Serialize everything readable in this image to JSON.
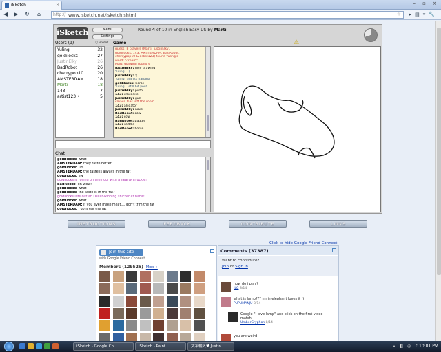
{
  "browser": {
    "tab_title": "iSketch",
    "url_lead": "http://",
    "url": "www.isketch.net/isketch.shtml"
  },
  "game": {
    "logo": "iSketch",
    "menu_label": "Menu",
    "settings_label": "Settings",
    "round_text_pre": "Round ",
    "round_num": "4",
    "round_text_mid": " of 10 in English Easy US by ",
    "drawer": "Marti",
    "users_label": "Users (9)",
    "away_label": "AWAY",
    "game_label": "Game",
    "chat_label": "Chat",
    "users": [
      {
        "name": "Yuling",
        "score": "32",
        "state": "normal"
      },
      {
        "name": "goldilocks",
        "score": "27",
        "state": "normal"
      },
      {
        "name": "JustinElky",
        "score": "26",
        "state": "dim"
      },
      {
        "name": "BadRobot",
        "score": "26",
        "state": "normal"
      },
      {
        "name": "cherrypop10",
        "score": "20",
        "state": "normal"
      },
      {
        "name": "AMSTERDAM",
        "score": "18",
        "state": "normal"
      },
      {
        "name": "Marti",
        "score": "18",
        "state": "me"
      },
      {
        "name": "143",
        "score": "7",
        "state": "normal"
      },
      {
        "name": "artist123 •",
        "score": "5",
        "state": "normal"
      }
    ],
    "gamelog": [
      {
        "style": "red",
        "nick": "",
        "text": "guess: 8 players (Marti, JustinElky,"
      },
      {
        "style": "red",
        "nick": "",
        "text": "goldilocks, 143, AMSTERDAM, BadRobot,"
      },
      {
        "style": "red",
        "nick": "",
        "text": "cherrypop10 & artist123) found Yuling's"
      },
      {
        "style": "red",
        "nick": "",
        "text": "word: \"cream\""
      },
      {
        "style": "red",
        "nick": "",
        "text": "Marti drawing round 4"
      },
      {
        "style": "",
        "nick": "JustinElky:",
        "text": " nice drawing"
      },
      {
        "style": "blue",
        "nick": "",
        "text": "Yuling: : )"
      },
      {
        "style": "",
        "nick": "JustinElky:",
        "text": " :("
      },
      {
        "style": "blue",
        "nick": "",
        "text": "Yuling: thanks hahaha"
      },
      {
        "style": "",
        "nick": "goldilocks:",
        "text": " horse"
      },
      {
        "style": "blue",
        "nick": "",
        "text": "Yuling: i still hit you!"
      },
      {
        "style": "",
        "nick": "JustinElky:",
        "text": " pistol"
      },
      {
        "style": "",
        "nick": "143:",
        "text": " crocodile"
      },
      {
        "style": "",
        "nick": "JustinElky:",
        "text": " gun"
      },
      {
        "style": "red",
        "nick": "",
        "text": "cmacs. has left the room."
      },
      {
        "style": "",
        "nick": "143:",
        "text": " alligator"
      },
      {
        "style": "",
        "nick": "JustinElky:",
        "text": " nove"
      },
      {
        "style": "",
        "nick": "BadRobot:",
        "text": " cow"
      },
      {
        "style": "",
        "nick": "143:",
        "text": " cow"
      },
      {
        "style": "",
        "nick": "BadRobot:",
        "text": " paddle"
      },
      {
        "style": "",
        "nick": "143:",
        "text": " saddle"
      },
      {
        "style": "",
        "nick": "BadRobot:",
        "text": " horse"
      }
    ],
    "chatlog": [
      {
        "style": "",
        "nick": "goldilocks:",
        "text": " what"
      },
      {
        "style": "",
        "nick": "AMSTERDAM:",
        "text": " they taste better"
      },
      {
        "style": "",
        "nick": "goldilocks:",
        "text": " um"
      },
      {
        "style": "",
        "nick": "AMSTERDAM:",
        "text": " the taste is always in the fat"
      },
      {
        "style": "",
        "nick": "goldilocks:",
        "text": " ew"
      },
      {
        "style": "pink",
        "nick": "",
        "text": "goldilocks is rolling on the floor with a hearty chuckle!"
      },
      {
        "style": "",
        "nick": "BadRobot:",
        "text": " oh wow!"
      },
      {
        "style": "",
        "nick": "goldilocks:",
        "text": " what"
      },
      {
        "style": "",
        "nick": "goldilocks:",
        "text": " the taste is in the fat?"
      },
      {
        "style": "pink",
        "nick": "",
        "text": "goldilocks lets out an Oscar-winning snicker at haha!"
      },
      {
        "style": "",
        "nick": "goldilocks:",
        "text": " what"
      },
      {
        "style": "",
        "nick": "AMSTERDAM:",
        "text": " if you ever make meat.... don't trim the fat"
      },
      {
        "style": "",
        "nick": "goldilocks:",
        "text": " i dont eat the fat"
      }
    ]
  },
  "buttons": {
    "instructions": "INSTRUCTIONS",
    "feedback": "FEEDBACK",
    "contribute": "CONTRIBUTE",
    "links": "LINKS"
  },
  "gfc": {
    "hide_link": "Click to hide Google Friend Connect",
    "join_label": "Join this site",
    "sub_label": "with Google Friend Connect",
    "members_label": "Members (129525)",
    "more_label": "More »"
  },
  "comments": {
    "header": "Comments (37387)",
    "want_text": "Want to contribute?",
    "join": "Join",
    "or": " or ",
    "signin": "Sign in",
    "items": [
      {
        "text": "how do i play?",
        "author": "ILG",
        "date": " 8/14"
      },
      {
        "text": "what is lamp??? mr irrelephant loves it :)",
        "author": "PUPUMANJU",
        "date": " 8/14"
      },
      {
        "text": "Google \"I love lamp\" and click on the first video",
        "text2": "match.",
        "author": "UmberGryphon",
        "date": " 8/14"
      },
      {
        "text": "you are weird",
        "author": "",
        "date": ""
      }
    ]
  },
  "taskbar": {
    "tasks": [
      "iSketch - Google Ch...",
      "iSketch - Paint",
      "文字輸入♥ Justin..."
    ],
    "clock": "10:01 PM"
  },
  "colors": {
    "avatars": [
      "#7a5a48",
      "#c9a27e",
      "#3a3a3a",
      "#b07060",
      "#d8d2c8",
      "#6b7a8c",
      "#2e2e2e",
      "#c28a6a",
      "#8b6b5a",
      "#e0c0a0",
      "#5a6a7a",
      "#a05a50",
      "#b8b8b8",
      "#4a4a4a",
      "#9a7a60",
      "#cf9f80",
      "#2a2a2a",
      "#d0d0d0",
      "#8a4a3a",
      "#6a5a4a",
      "#c0a090",
      "#3a4a5a",
      "#b09080",
      "#e8d8c8",
      "#c02020",
      "#7a6a5a",
      "#5a3a2a",
      "#9a9a9a",
      "#d0b090",
      "#4a3a3a",
      "#a08070",
      "#605040",
      "#e0a030",
      "#2a6aa0",
      "#8a8a8a",
      "#c0c0c0",
      "#704030",
      "#b0a090",
      "#d8c0a8",
      "#505050",
      "#6a6a6a",
      "#3060a0",
      "#a07050",
      "#c8b8a8",
      "#403030",
      "#906050",
      "#b8a898",
      "#e0d0c0"
    ]
  }
}
